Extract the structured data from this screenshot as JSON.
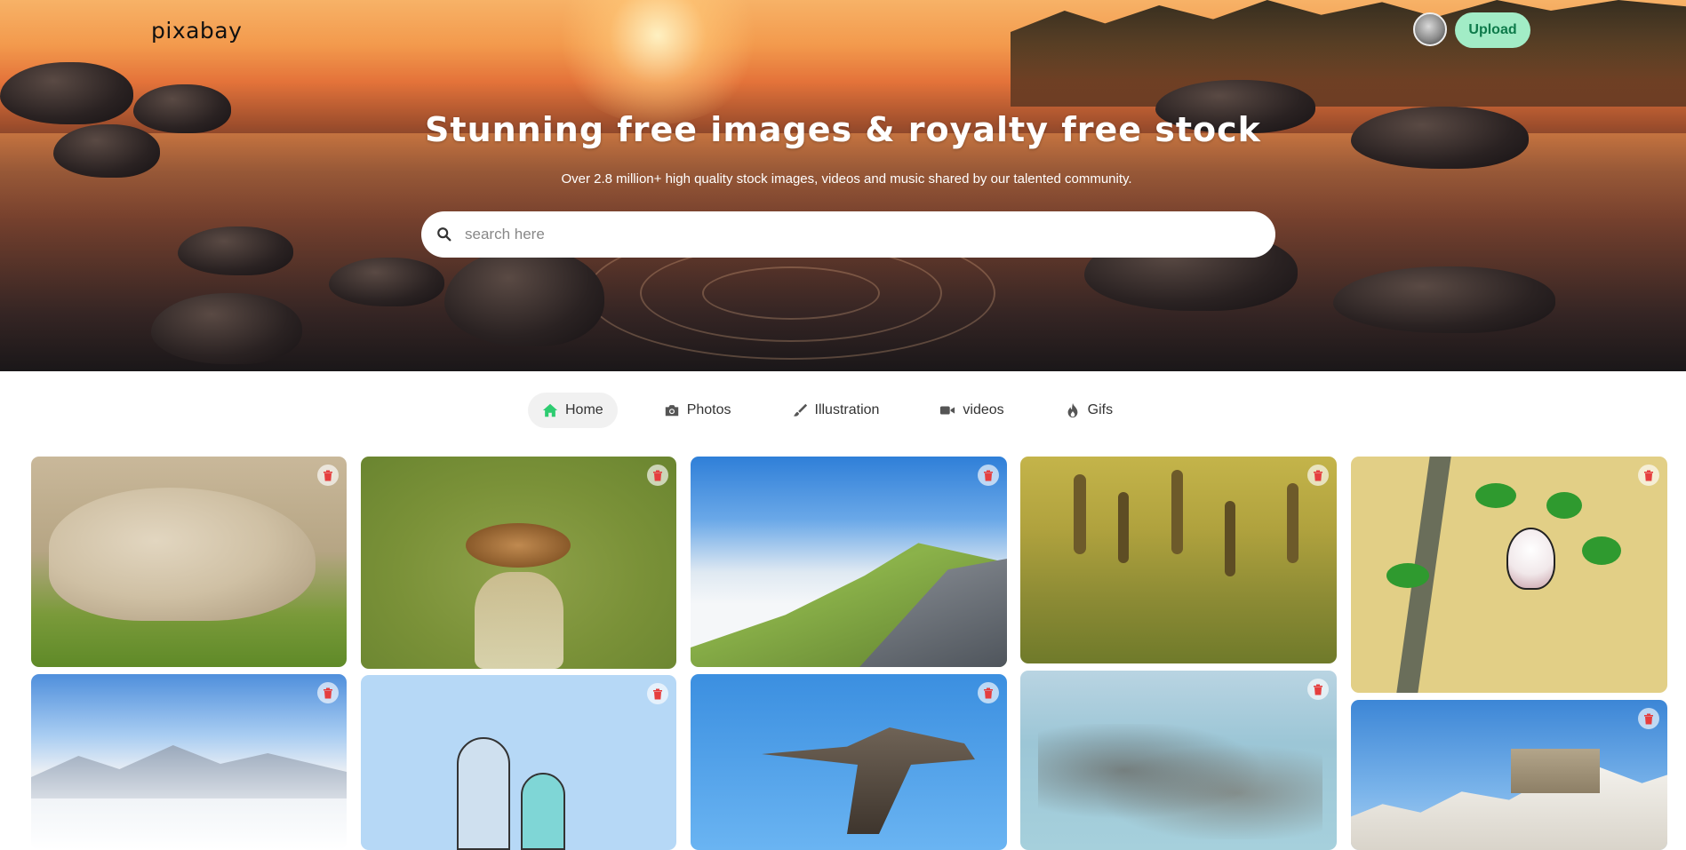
{
  "header": {
    "logo": "pixabay",
    "upload_label": "Upload"
  },
  "hero": {
    "title": "Stunning free images & royalty free stock",
    "subtitle": "Over 2.8 million+ high quality stock images, videos and music shared by our talented community.",
    "search_placeholder": "search here"
  },
  "nav": {
    "items": [
      {
        "label": "Home",
        "icon": "home-icon",
        "active": true
      },
      {
        "label": "Photos",
        "icon": "camera-icon",
        "active": false
      },
      {
        "label": "Illustration",
        "icon": "paintbrush-icon",
        "active": false
      },
      {
        "label": "videos",
        "icon": "video-icon",
        "active": false
      },
      {
        "label": "Gifs",
        "icon": "fire-icon",
        "active": false
      }
    ]
  },
  "gallery": {
    "images": [
      "stone head sculpture in grass",
      "dragonfly close-up on green",
      "green mountain above clouds",
      "grass seed heads",
      "illustrated bird on branch",
      "snowy trees and mountains",
      "illustrated family",
      "flying shorebird on blue sky",
      "flock of birds over sea",
      "white coastal town"
    ],
    "delete_icon": "trash-icon",
    "accent": "#e53e3e"
  },
  "colors": {
    "accent": "#2ecc71",
    "upload_bg": "#a2ecc6",
    "upload_text": "#0d7a4a"
  }
}
